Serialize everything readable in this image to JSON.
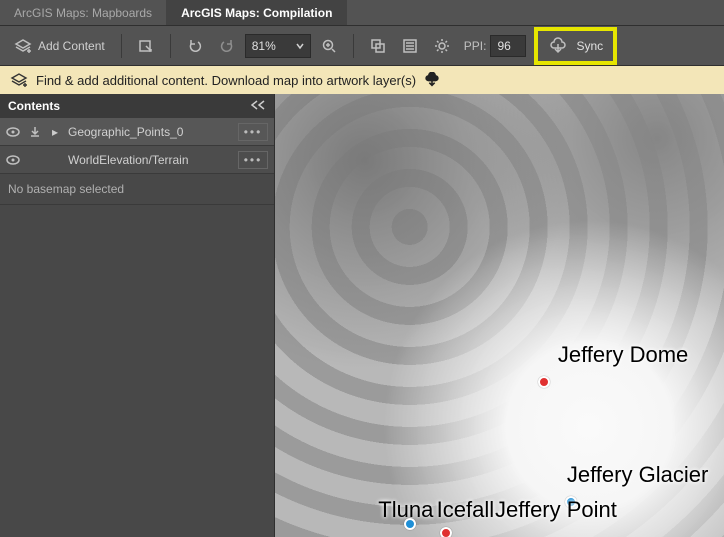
{
  "tabs": {
    "inactive": "ArcGIS Maps: Mapboards",
    "active": "ArcGIS Maps: Compilation"
  },
  "toolbar": {
    "add_content": "Add Content",
    "zoom_value": "81%",
    "ppi_label": "PPI:",
    "ppi_value": "96",
    "sync_label": "Sync"
  },
  "info_bar": {
    "text": "Find & add additional content. Download map into artwork layer(s)"
  },
  "panel": {
    "title": "Contents",
    "layers": [
      {
        "name": "Geographic_Points_0"
      },
      {
        "name": "WorldElevation/Terrain"
      }
    ],
    "no_basemap": "No basemap selected"
  },
  "map": {
    "labels": {
      "jeffery_dome": "Jeffery Dome",
      "jeffery_glacier": "Jeffery Glacier",
      "jeffery_point": "Jeffery Point",
      "tluna": "Tluna",
      "icefall": "Icefall"
    }
  }
}
